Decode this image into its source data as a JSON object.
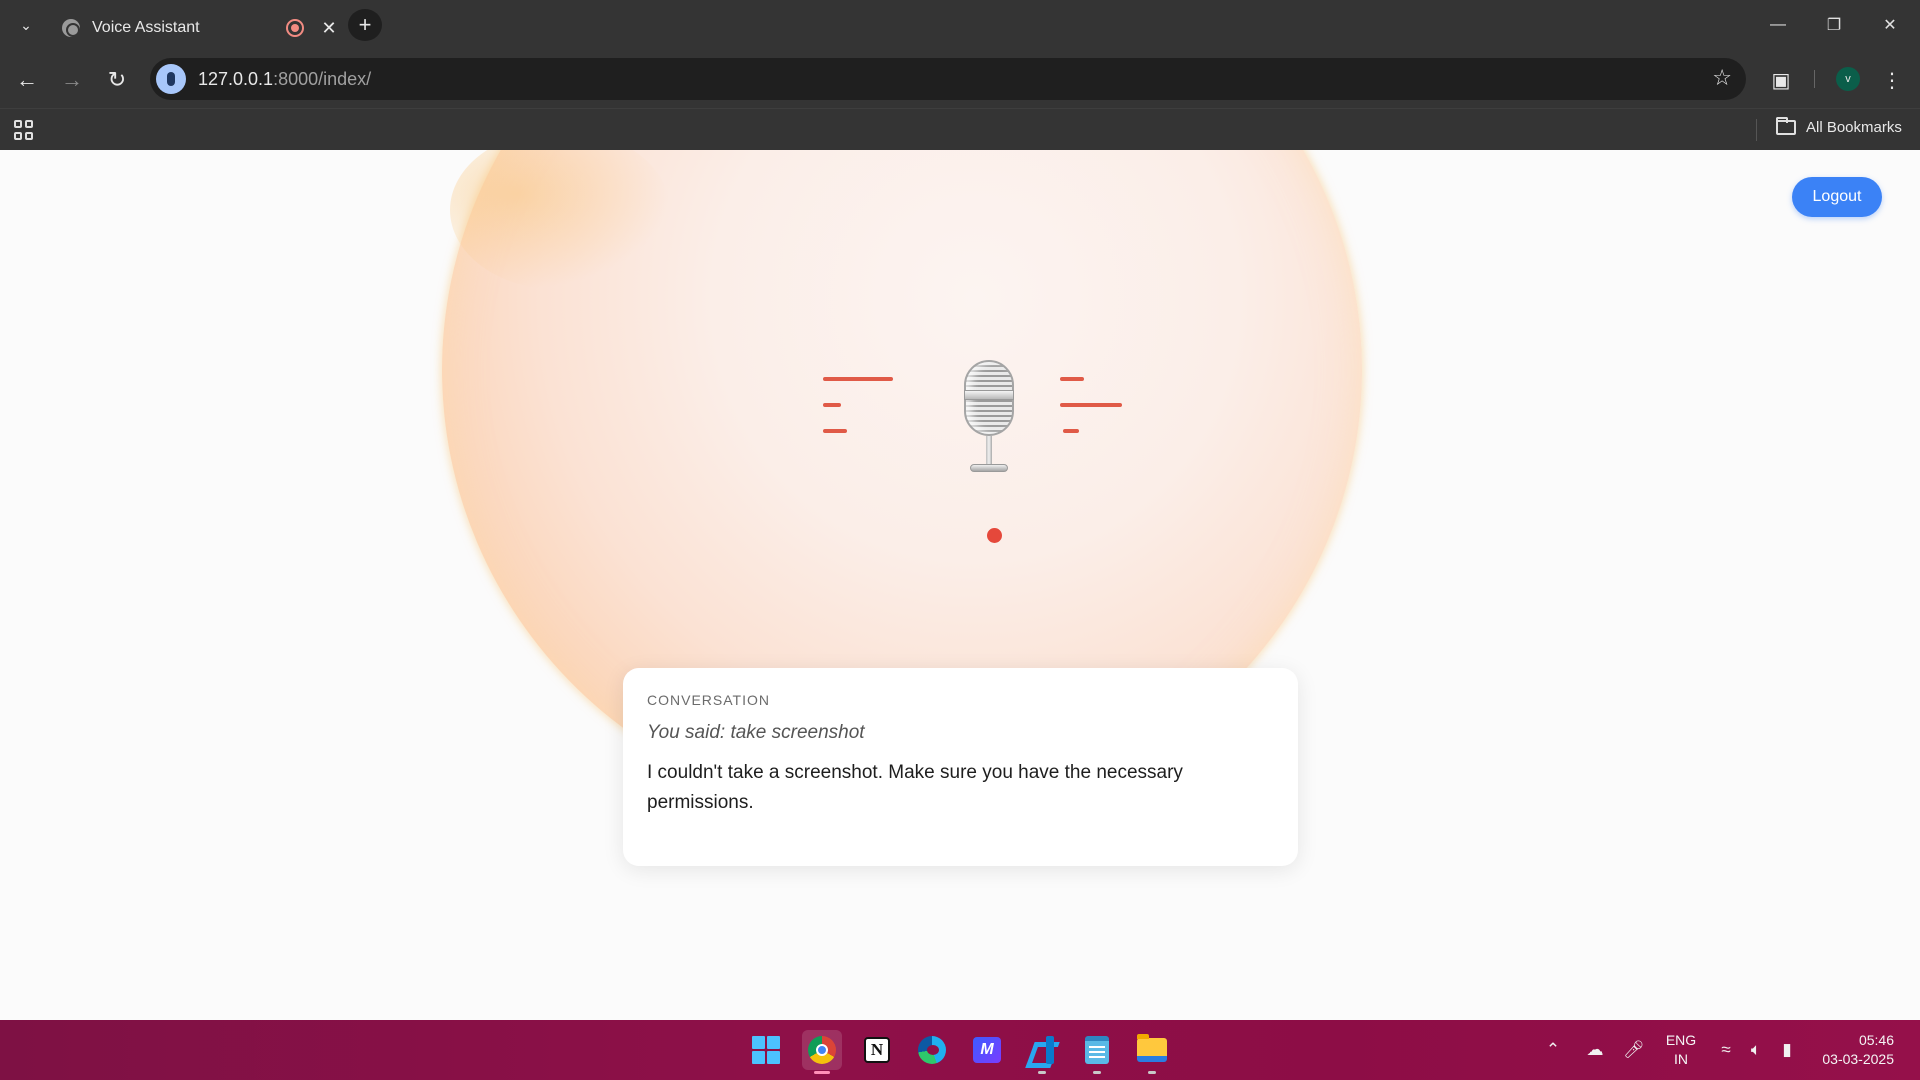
{
  "browser": {
    "tab_title": "Voice Assistant",
    "new_tab_symbol": "+",
    "url_host": "127.0.0.1",
    "url_rest": ":8000/index/",
    "all_bookmarks_label": "All Bookmarks",
    "profile_initial": "v",
    "icons": [
      "tab-list-icon",
      "globe-icon",
      "recording-icon",
      "close-icon",
      "back-icon",
      "forward-icon",
      "reload-icon",
      "mic-icon",
      "star-icon",
      "extensions-icon",
      "menu-icon",
      "apps-icon",
      "folder-icon"
    ]
  },
  "page": {
    "logout_label": "Logout",
    "conversation": {
      "label": "CONVERSATION",
      "you_said": "You said: take screenshot",
      "reply": "I couldn't take a screenshot. Make sure you have the necessary permissions."
    },
    "colors": {
      "accent": "#3b82f6",
      "wave": "#e05a47",
      "record_dot": "#e5483b"
    }
  },
  "taskbar": {
    "apps": [
      "start",
      "chrome",
      "notion",
      "edge",
      "ms-app",
      "vscode",
      "notepad",
      "file-explorer"
    ],
    "language_line1": "ENG",
    "language_line2": "IN",
    "time": "05:46",
    "date": "03-03-2025"
  }
}
